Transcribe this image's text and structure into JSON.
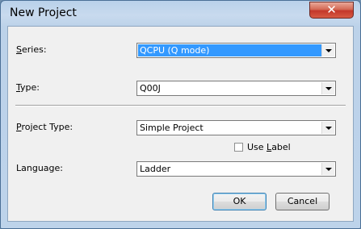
{
  "window": {
    "title": "New Project",
    "close_glyph": "✕"
  },
  "form": {
    "series": {
      "label_mnemonic": "S",
      "label_rest": "eries:",
      "value": "QCPU (Q mode)"
    },
    "type": {
      "label_mnemonic": "T",
      "label_rest": "ype:",
      "value": "Q00J"
    },
    "project_type": {
      "label_mnemonic": "P",
      "label_rest": "roject Type:",
      "value": "Simple Project"
    },
    "use_label": {
      "pre": "Use ",
      "mnemonic": "L",
      "post": "abel",
      "checked": false
    },
    "language": {
      "label": "Language:",
      "value": "Ladder"
    }
  },
  "buttons": {
    "ok": "OK",
    "cancel": "Cancel"
  },
  "colors": {
    "selection": "#3399ff",
    "close_button": "#c4372a",
    "frame": "#bcd2e9"
  }
}
